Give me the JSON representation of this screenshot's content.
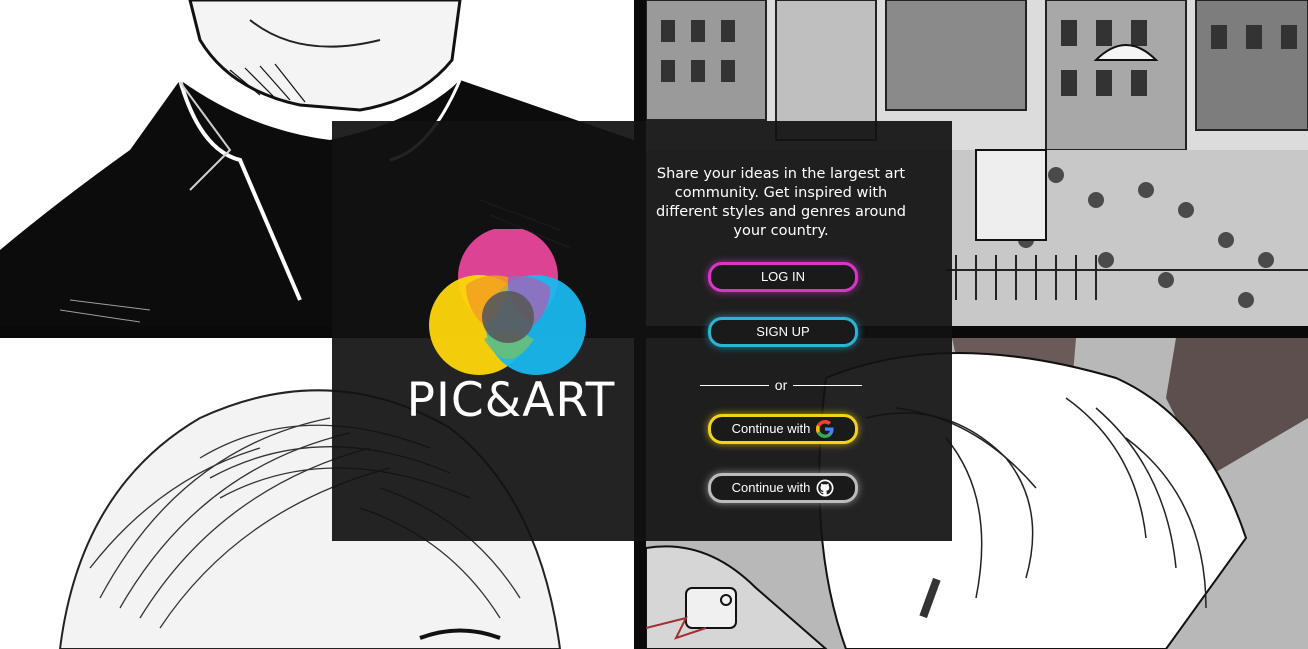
{
  "brand": {
    "name": "PIC&ART",
    "colors": {
      "pink": "#e83e8c",
      "yellow": "#ffd60a",
      "cyan": "#18b6ea",
      "panel": "#121212"
    }
  },
  "tagline": "Share your ideas in the largest art community. Get inspired with different styles and genres around your country.",
  "auth": {
    "login_label": "LOG IN",
    "signup_label": "SIGN UP",
    "separator": "or",
    "google_label": "Continue with",
    "google_icon": "google-icon",
    "github_label": "Continue with",
    "github_icon": "github-icon"
  },
  "background": {
    "tiles": [
      "ink-portrait-collar",
      "ink-city-street",
      "ink-hair-portrait",
      "manga-character"
    ]
  }
}
